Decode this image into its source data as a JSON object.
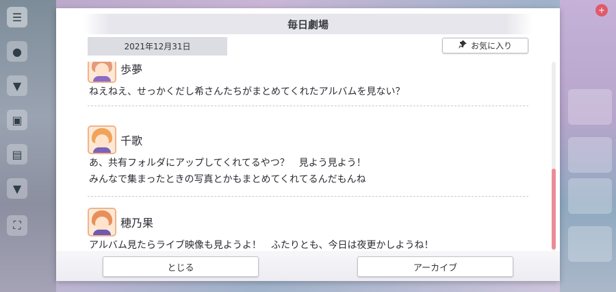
{
  "dialog": {
    "title": "毎日劇場",
    "date": "2021年12月31日",
    "favorite_label": "お気に入り",
    "close_label": "とじる",
    "archive_label": "アーカイブ"
  },
  "messages": [
    {
      "speaker": "歩夢",
      "lines": [
        "ねえねえ、せっかくだし希さんたちがまとめてくれたアルバムを見ない？"
      ]
    },
    {
      "speaker": "千歌",
      "lines": [
        "あ、共有フォルダにアップしてくれてるやつ？　見よう見よう！",
        "みんなで集まったときの写真とかもまとめてくれてるんだもんね"
      ]
    },
    {
      "speaker": "穂乃果",
      "lines": [
        "アルバム見たらライブ映像も見ようよ！　ふたりとも、今日は夜更かしようね！"
      ]
    }
  ],
  "colors": {
    "scroll_thumb": "#ea8d98",
    "avatar_border": "#f0b48c"
  },
  "icons": {
    "favorite": "pin-icon",
    "menu": "hamburger-menu-icon"
  }
}
